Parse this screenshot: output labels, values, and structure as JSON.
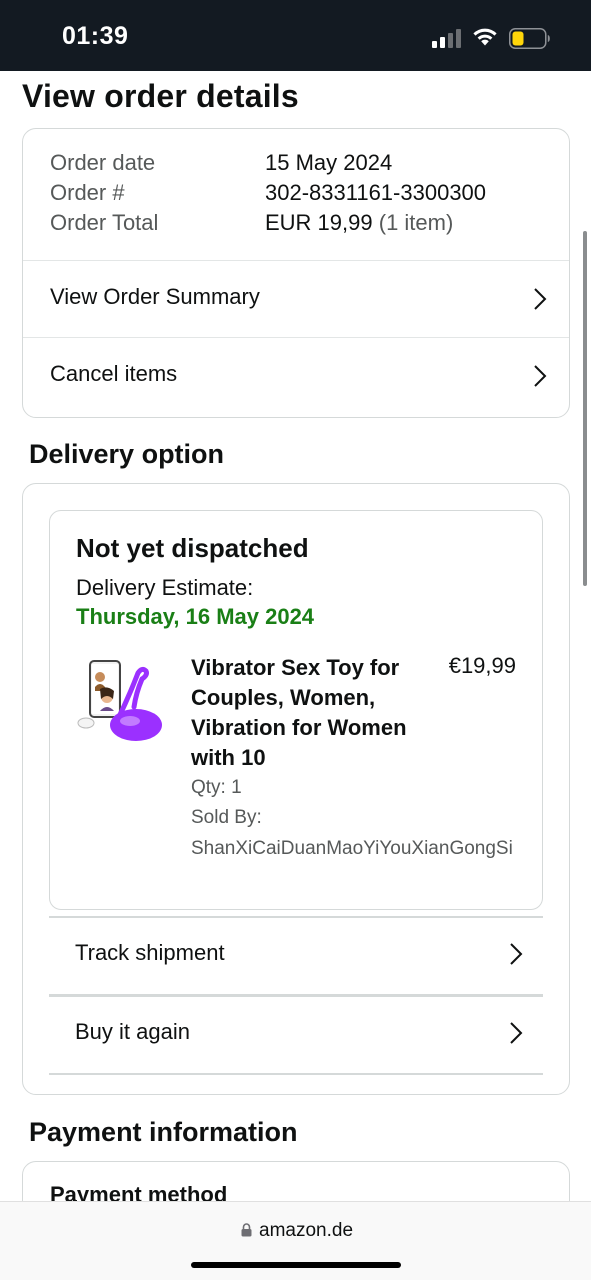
{
  "status_bar": {
    "time": "01:39"
  },
  "page_title": "View order details",
  "order_summary": {
    "rows": [
      {
        "label": "Order date",
        "value": "15 May 2024"
      },
      {
        "label": "Order #",
        "value": "302-8331161-3300300"
      },
      {
        "label": "Order Total",
        "value": "EUR 19,99",
        "extra": "(1 item)"
      }
    ],
    "view_summary_label": "View Order Summary",
    "cancel_items_label": "Cancel items"
  },
  "delivery": {
    "section_title": "Delivery option",
    "status": "Not yet dispatched",
    "estimate_label": "Delivery Estimate:",
    "estimate_date": "Thursday, 16 May 2024",
    "product": {
      "title": "Vibrator Sex Toy for Couples, Women, Vibration for Women with 10",
      "price": "€19,99",
      "qty": "Qty: 1",
      "sold_by_label": "Sold By:",
      "seller": "ShanXiCaiDuanMaoYiYouXianGongSi"
    },
    "track_label": "Track shipment",
    "buy_again_label": "Buy it again"
  },
  "payment": {
    "section_title": "Payment information",
    "method_label": "Payment method"
  },
  "browser": {
    "url": "amazon.de"
  },
  "colors": {
    "status_bar": "#131a22",
    "estimate_date": "#1a7f16",
    "border": "#d5d9d9",
    "product_purple": "#8a2be2"
  }
}
